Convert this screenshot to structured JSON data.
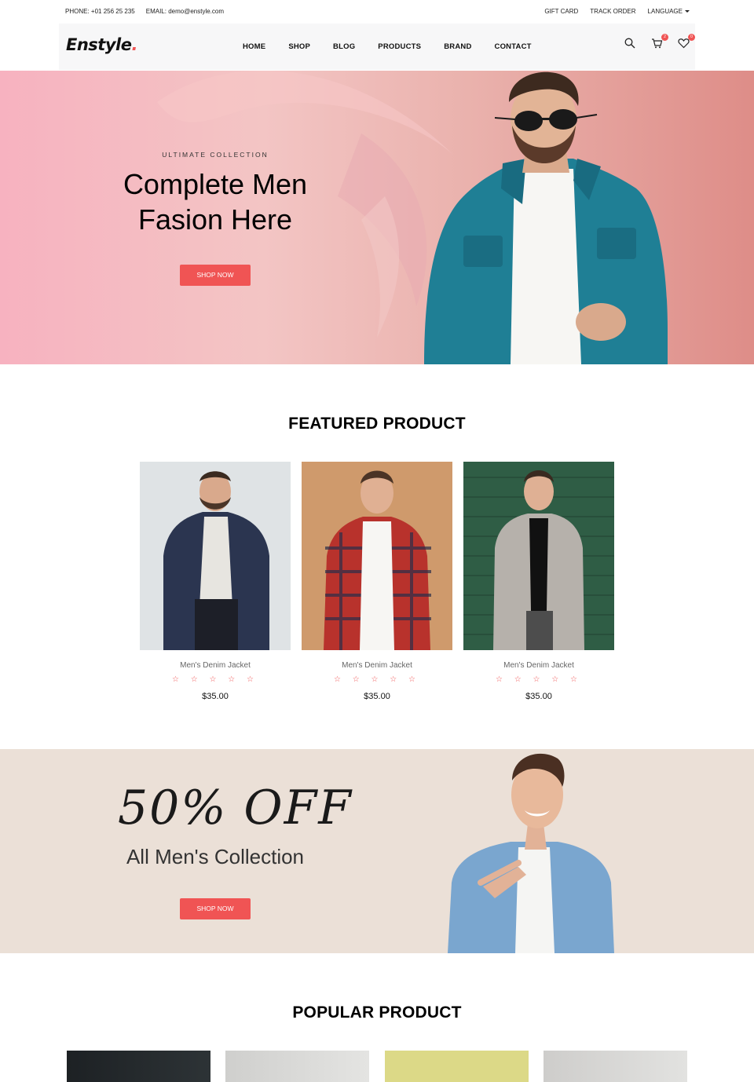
{
  "topbar": {
    "phone": "PHONE: +01 256 25 235",
    "email": "EMAIL: demo@enstyle.com",
    "gift_card": "GIFT CARD",
    "track_order": "TRACK ORDER",
    "language": "LANGUAGE"
  },
  "nav": {
    "logo": "Enstyle",
    "logo_dot": ".",
    "items": [
      "HOME",
      "SHOP",
      "BLOG",
      "PRODUCTS",
      "BRAND",
      "CONTACT"
    ],
    "cart_count": "2",
    "wishlist_count": "0",
    "icons": [
      "search-icon",
      "cart-icon",
      "heart-icon"
    ]
  },
  "hero": {
    "subtitle": "ULTIMATE COLLECTION",
    "title_line1": "Complete Men",
    "title_line2": "Fasion Here",
    "button": "SHOP NOW"
  },
  "featured": {
    "title": "FEATURED PRODUCT",
    "products": [
      {
        "name": "Men's Denim Jacket",
        "stars": "☆ ☆ ☆ ☆ ☆",
        "price": "$35.00"
      },
      {
        "name": "Men's Denim Jacket",
        "stars": "☆ ☆ ☆ ☆ ☆",
        "price": "$35.00"
      },
      {
        "name": "Men's Denim Jacket",
        "stars": "☆ ☆ ☆ ☆ ☆",
        "price": "$35.00"
      }
    ]
  },
  "promo": {
    "discount": "50% OFF",
    "subtitle": "All Men's Collection",
    "button": "SHOP NOW"
  },
  "popular": {
    "title": "POPULAR PRODUCT"
  },
  "colors": {
    "accent": "#f05454",
    "promo_bg": "#ebe0d7",
    "nav_bg": "#f7f7f8"
  }
}
